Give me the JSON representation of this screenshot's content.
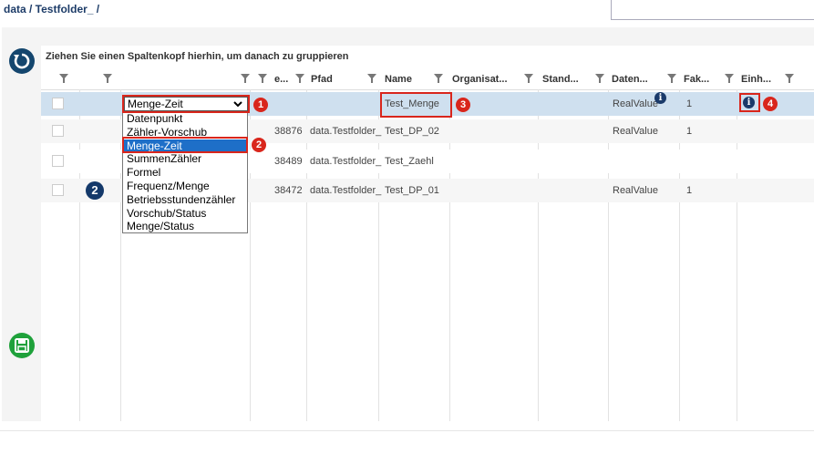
{
  "breadcrumb": "data / Testfolder_ /",
  "group_hint": "Ziehen Sie einen Spaltenkopf hierhin, um danach zu gruppieren",
  "columns": [
    "e...",
    "Pfad",
    "Name",
    "Organisat...",
    "Stand...",
    "Daten...",
    "Fak...",
    "Einh..."
  ],
  "rows": [
    {
      "id": "",
      "pfad": "",
      "name": "Test_Menge",
      "daten": "RealValue",
      "fak": "1"
    },
    {
      "id": "38876",
      "pfad": "data.Testfolder_",
      "name": "Test_DP_02",
      "daten": "RealValue",
      "fak": "1"
    },
    {
      "id": "38489",
      "pfad": "data.Testfolder_",
      "name": "Test_Zaehl",
      "daten": "",
      "fak": ""
    },
    {
      "id": "38472",
      "pfad": "data.Testfolder_",
      "name": "Test_DP_01",
      "daten": "RealValue",
      "fak": "1"
    }
  ],
  "select": {
    "value": "Menge-Zeit",
    "options": [
      "Datenpunkt",
      "Zähler-Vorschub",
      "Menge-Zeit",
      "SummenZähler",
      "Formel",
      "Frequenz/Menge",
      "Betriebsstundenzähler",
      "Vorschub/Status",
      "Menge/Status"
    ],
    "selected_index": 2
  },
  "annotations": {
    "b1": "1",
    "b2": "2",
    "b3": "3",
    "b4": "4",
    "blue2": "2"
  },
  "icons": {
    "reload": "reload-icon",
    "save": "save-icon",
    "info": "info-icon",
    "filter": "filter-icon"
  },
  "colors": {
    "accent": "#d9261c",
    "selected_row": "#cfe0ef",
    "dropdown_selected": "#1e6fc8",
    "save": "#1fa13b",
    "reload": "#14466e"
  }
}
